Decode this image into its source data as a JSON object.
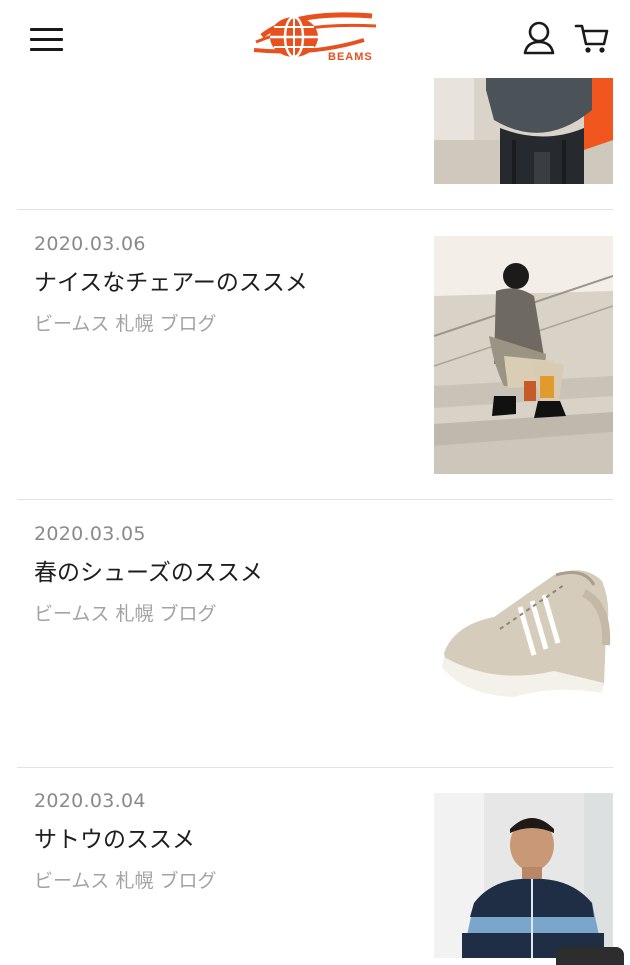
{
  "header": {
    "menu_icon": "hamburger-menu-icon",
    "logo_text": "BEAMS",
    "account_icon": "user-icon",
    "cart_icon": "cart-icon",
    "brand_color": "#e8501e"
  },
  "articles": [
    {
      "date": "",
      "title": "",
      "category": "",
      "thumb": "backpack-photo"
    },
    {
      "date": "2020.03.06",
      "title": "ナイスなチェアーのススメ",
      "category": "ビームス 札幌 ブログ",
      "thumb": "person-sitting-on-stairs-photo"
    },
    {
      "date": "2020.03.05",
      "title": "春のシューズのススメ",
      "category": "ビームス 札幌 ブログ",
      "thumb": "beige-sneakers-photo"
    },
    {
      "date": "2020.03.04",
      "title": "サトウのススメ",
      "category": "ビームス 札幌 ブログ",
      "thumb": "man-in-blue-jacket-photo"
    }
  ]
}
